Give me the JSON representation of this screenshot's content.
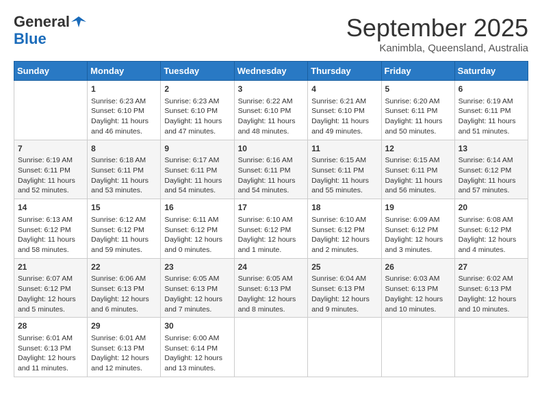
{
  "header": {
    "logo_line1": "General",
    "logo_line2": "Blue",
    "month": "September 2025",
    "location": "Kanimbla, Queensland, Australia"
  },
  "weekdays": [
    "Sunday",
    "Monday",
    "Tuesday",
    "Wednesday",
    "Thursday",
    "Friday",
    "Saturday"
  ],
  "weeks": [
    [
      {
        "day": "",
        "info": ""
      },
      {
        "day": "1",
        "info": "Sunrise: 6:23 AM\nSunset: 6:10 PM\nDaylight: 11 hours\nand 46 minutes."
      },
      {
        "day": "2",
        "info": "Sunrise: 6:23 AM\nSunset: 6:10 PM\nDaylight: 11 hours\nand 47 minutes."
      },
      {
        "day": "3",
        "info": "Sunrise: 6:22 AM\nSunset: 6:10 PM\nDaylight: 11 hours\nand 48 minutes."
      },
      {
        "day": "4",
        "info": "Sunrise: 6:21 AM\nSunset: 6:10 PM\nDaylight: 11 hours\nand 49 minutes."
      },
      {
        "day": "5",
        "info": "Sunrise: 6:20 AM\nSunset: 6:11 PM\nDaylight: 11 hours\nand 50 minutes."
      },
      {
        "day": "6",
        "info": "Sunrise: 6:19 AM\nSunset: 6:11 PM\nDaylight: 11 hours\nand 51 minutes."
      }
    ],
    [
      {
        "day": "7",
        "info": "Sunrise: 6:19 AM\nSunset: 6:11 PM\nDaylight: 11 hours\nand 52 minutes."
      },
      {
        "day": "8",
        "info": "Sunrise: 6:18 AM\nSunset: 6:11 PM\nDaylight: 11 hours\nand 53 minutes."
      },
      {
        "day": "9",
        "info": "Sunrise: 6:17 AM\nSunset: 6:11 PM\nDaylight: 11 hours\nand 54 minutes."
      },
      {
        "day": "10",
        "info": "Sunrise: 6:16 AM\nSunset: 6:11 PM\nDaylight: 11 hours\nand 54 minutes."
      },
      {
        "day": "11",
        "info": "Sunrise: 6:15 AM\nSunset: 6:11 PM\nDaylight: 11 hours\nand 55 minutes."
      },
      {
        "day": "12",
        "info": "Sunrise: 6:15 AM\nSunset: 6:11 PM\nDaylight: 11 hours\nand 56 minutes."
      },
      {
        "day": "13",
        "info": "Sunrise: 6:14 AM\nSunset: 6:12 PM\nDaylight: 11 hours\nand 57 minutes."
      }
    ],
    [
      {
        "day": "14",
        "info": "Sunrise: 6:13 AM\nSunset: 6:12 PM\nDaylight: 11 hours\nand 58 minutes."
      },
      {
        "day": "15",
        "info": "Sunrise: 6:12 AM\nSunset: 6:12 PM\nDaylight: 11 hours\nand 59 minutes."
      },
      {
        "day": "16",
        "info": "Sunrise: 6:11 AM\nSunset: 6:12 PM\nDaylight: 12 hours\nand 0 minutes."
      },
      {
        "day": "17",
        "info": "Sunrise: 6:10 AM\nSunset: 6:12 PM\nDaylight: 12 hours\nand 1 minute."
      },
      {
        "day": "18",
        "info": "Sunrise: 6:10 AM\nSunset: 6:12 PM\nDaylight: 12 hours\nand 2 minutes."
      },
      {
        "day": "19",
        "info": "Sunrise: 6:09 AM\nSunset: 6:12 PM\nDaylight: 12 hours\nand 3 minutes."
      },
      {
        "day": "20",
        "info": "Sunrise: 6:08 AM\nSunset: 6:12 PM\nDaylight: 12 hours\nand 4 minutes."
      }
    ],
    [
      {
        "day": "21",
        "info": "Sunrise: 6:07 AM\nSunset: 6:12 PM\nDaylight: 12 hours\nand 5 minutes."
      },
      {
        "day": "22",
        "info": "Sunrise: 6:06 AM\nSunset: 6:13 PM\nDaylight: 12 hours\nand 6 minutes."
      },
      {
        "day": "23",
        "info": "Sunrise: 6:05 AM\nSunset: 6:13 PM\nDaylight: 12 hours\nand 7 minutes."
      },
      {
        "day": "24",
        "info": "Sunrise: 6:05 AM\nSunset: 6:13 PM\nDaylight: 12 hours\nand 8 minutes."
      },
      {
        "day": "25",
        "info": "Sunrise: 6:04 AM\nSunset: 6:13 PM\nDaylight: 12 hours\nand 9 minutes."
      },
      {
        "day": "26",
        "info": "Sunrise: 6:03 AM\nSunset: 6:13 PM\nDaylight: 12 hours\nand 10 minutes."
      },
      {
        "day": "27",
        "info": "Sunrise: 6:02 AM\nSunset: 6:13 PM\nDaylight: 12 hours\nand 10 minutes."
      }
    ],
    [
      {
        "day": "28",
        "info": "Sunrise: 6:01 AM\nSunset: 6:13 PM\nDaylight: 12 hours\nand 11 minutes."
      },
      {
        "day": "29",
        "info": "Sunrise: 6:01 AM\nSunset: 6:13 PM\nDaylight: 12 hours\nand 12 minutes."
      },
      {
        "day": "30",
        "info": "Sunrise: 6:00 AM\nSunset: 6:14 PM\nDaylight: 12 hours\nand 13 minutes."
      },
      {
        "day": "",
        "info": ""
      },
      {
        "day": "",
        "info": ""
      },
      {
        "day": "",
        "info": ""
      },
      {
        "day": "",
        "info": ""
      }
    ]
  ]
}
